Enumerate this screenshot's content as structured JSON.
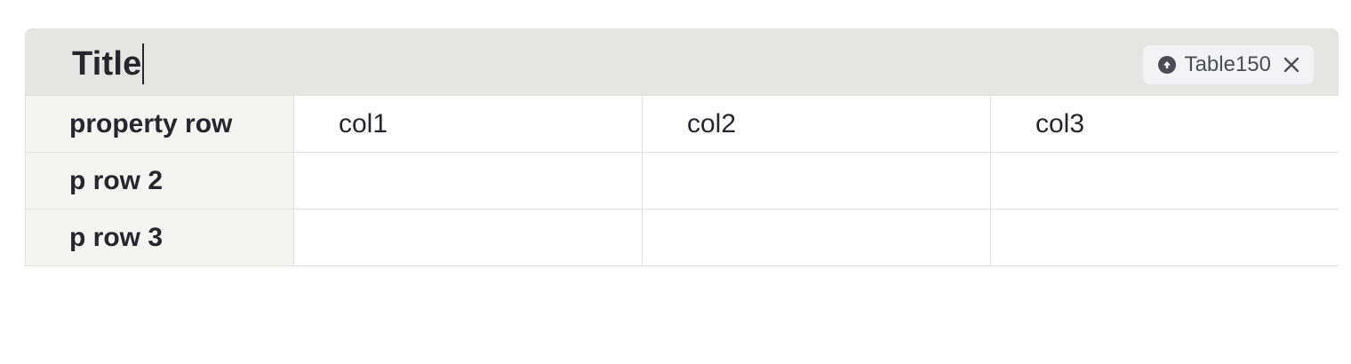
{
  "header": {
    "title": "Title",
    "tag": {
      "icon": "arrow-up-circle-icon",
      "label": "Table150",
      "close_icon": "close-icon"
    }
  },
  "table": {
    "rows": [
      {
        "property": "property row",
        "cells": [
          "col1",
          "col2",
          "col3"
        ]
      },
      {
        "property": "p row 2",
        "cells": [
          "",
          "",
          ""
        ]
      },
      {
        "property": "p row 3",
        "cells": [
          "",
          "",
          ""
        ]
      }
    ]
  },
  "colors": {
    "header_bg": "#e5e5e4",
    "property_bg": "#f4f5f2",
    "border": "#e2e2e2",
    "tag_bg": "#f3f3f6",
    "text": "#26262c"
  }
}
